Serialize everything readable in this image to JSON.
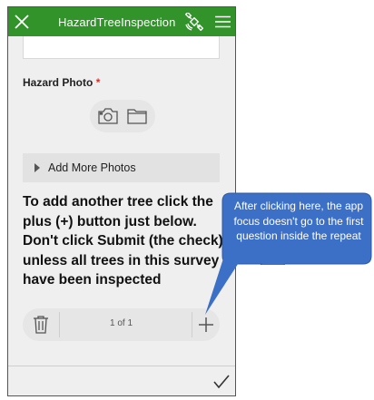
{
  "titlebar": {
    "title": "HazardTreeInspection",
    "close_icon": "close-icon",
    "gps_icon": "satellite-gps-icon",
    "menu_icon": "hamburger-menu-icon",
    "color": "#31932a"
  },
  "form": {
    "photo_label": "Hazard Photo",
    "required_marker": "*",
    "add_more_photos": "Add More Photos",
    "instructions": "To add another tree click the plus (+) button just below. Don't click Submit (the check) unless all trees in this survey have been inspected"
  },
  "repeat": {
    "counter": "1 of 1"
  },
  "callout": {
    "text": "After clicking here, the app focus doesn't go to the first question inside the repeat",
    "color": "#3c6fc6"
  }
}
